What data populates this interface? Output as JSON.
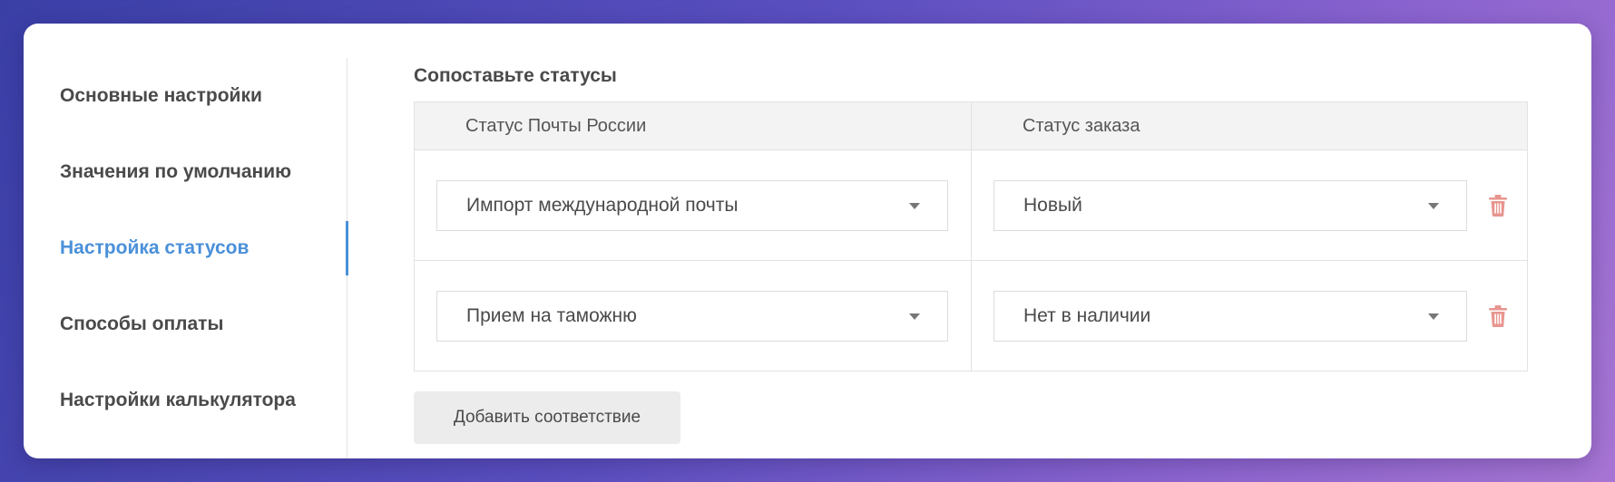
{
  "sidebar": {
    "items": [
      {
        "label": "Основные настройки"
      },
      {
        "label": "Значения по умолчанию"
      },
      {
        "label": "Настройка статусов"
      },
      {
        "label": "Способы оплаты"
      },
      {
        "label": "Настройки калькулятора"
      }
    ],
    "active_index": 2
  },
  "main": {
    "title": "Сопоставьте статусы",
    "columns": [
      "Статус Почты России",
      "Статус заказа"
    ],
    "rows": [
      {
        "post_status": "Импорт международной почты",
        "order_status": "Новый"
      },
      {
        "post_status": "Прием на таможню",
        "order_status": "Нет в наличии"
      }
    ],
    "add_button_label": "Добавить соответствие"
  },
  "colors": {
    "accent": "#4a90d9",
    "delete_icon": "#e8958f"
  },
  "icons": {
    "dropdown": "chevron-down-icon",
    "delete": "trash-icon"
  }
}
